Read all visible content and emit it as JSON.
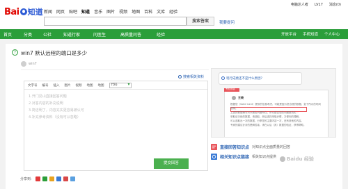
{
  "logo": {
    "text_bai": "Bai",
    "text_zhi": "知道"
  },
  "nav_links": [
    "新闻",
    "网页",
    "贴吧",
    "知道",
    "音乐",
    "图片",
    "视频",
    "地图",
    "百科",
    "文库",
    "经验"
  ],
  "nav_active_index": 3,
  "userbar": {
    "username": "电脑达人者",
    "level": "LV17",
    "messages": "消息(0)"
  },
  "search": {
    "placeholder": "",
    "button_label": "搜索答案",
    "ask_link": "我要提问"
  },
  "green_nav": {
    "items": [
      "首页",
      "分类",
      "公社",
      "知道行家",
      "问医生",
      "高质量问答",
      "经验"
    ],
    "right_items": [
      "开放平台",
      "手机知道",
      "个人中心"
    ]
  },
  "question": {
    "icon": "?",
    "title": "win7 默认远程的端口是多少",
    "asker": "win7"
  },
  "search_related": "搜索相关资料",
  "toolbar": {
    "items": [
      "文字号",
      "编号",
      "插入",
      "图片",
      "视频",
      "地图",
      "地图"
    ],
    "dropdown_value": "代码"
  },
  "tips": [
    "1.开门见山直接回答问题",
    "2.对答内容的补充说明",
    "3.简洁明了，内容充实更容易被认可",
    "4.补充参考资料（没有可以忽略）"
  ],
  "submit_label": "提交回答",
  "share": {
    "label": "分享到:"
  },
  "promo": {
    "question": "现行成绩还不是什么原因?",
    "tag": "专业回答",
    "answerer": "王晓",
    "lines": [
      "根据您（Solid Card）提供的信息考虑，可能是因为您出现的数据，如下所示的时间说明。",
      "上述的数据情况可以看出问题所在，所以建议您的问题是真实...",
      "采取该手段的数据，请选取，然后选择采取步骤，方便你的理解。",
      "可以选取出一次的数据，分享您的主要内容一次，还有其他的内容。",
      "专家的建议针对的是解答者，请在以后（其）数据的验证，获得帮助。"
    ]
  },
  "features": [
    {
      "title": "直接回答知识点",
      "desc": "对知识点全面质量的回答"
    },
    {
      "title": "相关知识点链接",
      "desc": "相关知识点提供"
    }
  ],
  "watermark": "Baidu 经验",
  "colors": {
    "green": "#2b9e3a",
    "red": "#e10601",
    "blue": "#2d5bd5",
    "link": "#2d64b3"
  }
}
